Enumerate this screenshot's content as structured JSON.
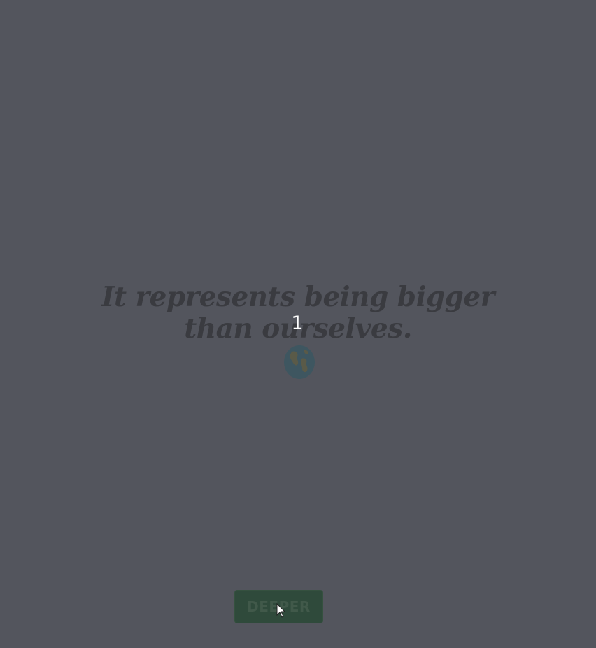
{
  "quote": {
    "text": "It represents being bigger than ourselves."
  },
  "counter": {
    "value": "1"
  },
  "emoji": {
    "icon": "globe-emoji-icon"
  },
  "actions": {
    "deeper_label": "DEEPER"
  },
  "colors": {
    "background": "#53555d",
    "quote_text": "#3a3b40",
    "button_background": "#2f4a3b",
    "button_text": "#41594a",
    "counter_text": "#ffffff"
  }
}
